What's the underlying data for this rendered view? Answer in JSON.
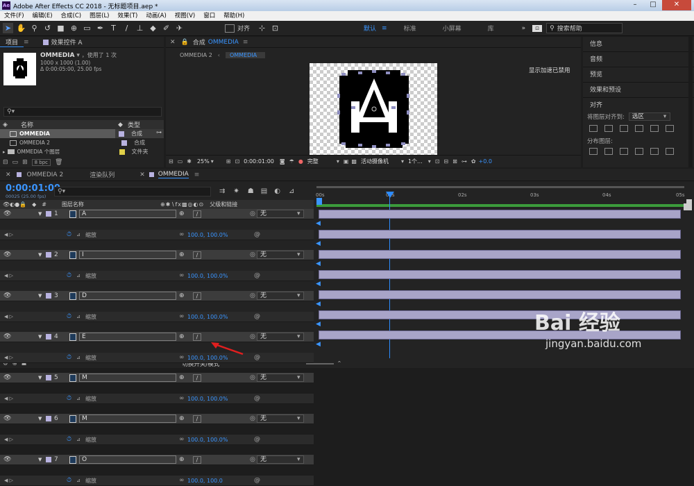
{
  "title_bar": {
    "app_title": "Adobe After Effects CC 2018 - 无标题项目.aep *",
    "logo_text": "Ae"
  },
  "menu": [
    "文件(F)",
    "编辑(E)",
    "合成(C)",
    "图层(L)",
    "效果(T)",
    "动画(A)",
    "视图(V)",
    "窗口",
    "帮助(H)"
  ],
  "toolbar": {
    "align_label": "对齐",
    "workspaces": [
      "默认",
      "标准",
      "小屏幕",
      "库"
    ],
    "active_workspace": "默认",
    "search_label": "搜索帮助"
  },
  "project": {
    "tabs": [
      "项目",
      "效果控件 A"
    ],
    "item_name": "OMMEDIA",
    "used_count": "，使用了 1 次",
    "dimensions": "1000 x 1000 (1.00)",
    "duration": "Δ 0:00:05:00, 25.00 fps",
    "col_name": "名称",
    "col_type": "类型",
    "items": [
      {
        "name": "OMMEDIA",
        "type": "合成",
        "color": "#b8b2e0"
      },
      {
        "name": "OMMEDIA 2",
        "type": "合成",
        "color": "#b8b2e0"
      },
      {
        "name": "OMMEDIA 个图层",
        "type": "文件夹",
        "color": "#e0d048"
      }
    ],
    "bpc": "8 bpc"
  },
  "viewer": {
    "comp_label": "合成",
    "comp_name": "OMMEDIA",
    "breadcrumbs": [
      "OMMEDIA 2",
      "OMMEDIA"
    ],
    "gpu_notice": "显示加速已禁用",
    "zoom": "25%",
    "timecode": "0:00:01:00",
    "resolution": "完整",
    "camera": "活动摄像机",
    "views": "1个...",
    "exposure": "+0.0"
  },
  "right_panel": {
    "items": [
      "信息",
      "音频",
      "预览",
      "效果和预设"
    ],
    "align_title": "对齐",
    "align_to_label": "将图层对齐到:",
    "align_to_value": "选区",
    "distribute_label": "分布图层:"
  },
  "timeline": {
    "tabs": [
      "OMMEDIA 2",
      "渲染队列",
      "OMMEDIA"
    ],
    "active_tab": "OMMEDIA",
    "timecode": "0:00:01:00",
    "fps_note": "00025 (25.00 fps)",
    "col_layer_name": "图层名称",
    "col_parent": "父级和链接",
    "ruler": [
      "00s",
      "01s",
      "02s",
      "03s",
      "04s",
      "05s"
    ],
    "scale_label": "缩放",
    "layers": [
      {
        "num": "1",
        "name": "A",
        "parent": "无",
        "scale": "100.0, 100.0%"
      },
      {
        "num": "2",
        "name": "I",
        "parent": "无",
        "scale": "100.0, 100.0%"
      },
      {
        "num": "3",
        "name": "D",
        "parent": "无",
        "scale": "100.0, 100.0%"
      },
      {
        "num": "4",
        "name": "E",
        "parent": "无",
        "scale": "100.0, 100.0%"
      },
      {
        "num": "5",
        "name": "M",
        "parent": "无",
        "scale": "100.0, 100.0%"
      },
      {
        "num": "6",
        "name": "M",
        "parent": "无",
        "scale": "100.0, 100.0%"
      },
      {
        "num": "7",
        "name": "O",
        "parent": "无",
        "scale": "100.0, 100.0"
      }
    ],
    "footer_label": "切换开关/模式"
  },
  "watermark": {
    "brand": "Bai 经验",
    "url": "jingyan.baidu.com"
  },
  "colors": {
    "accent": "#3a95ff",
    "layer_bar": "#a8a4c8",
    "playhead": "#2d8cff",
    "work_area": "#3b9b3b"
  }
}
